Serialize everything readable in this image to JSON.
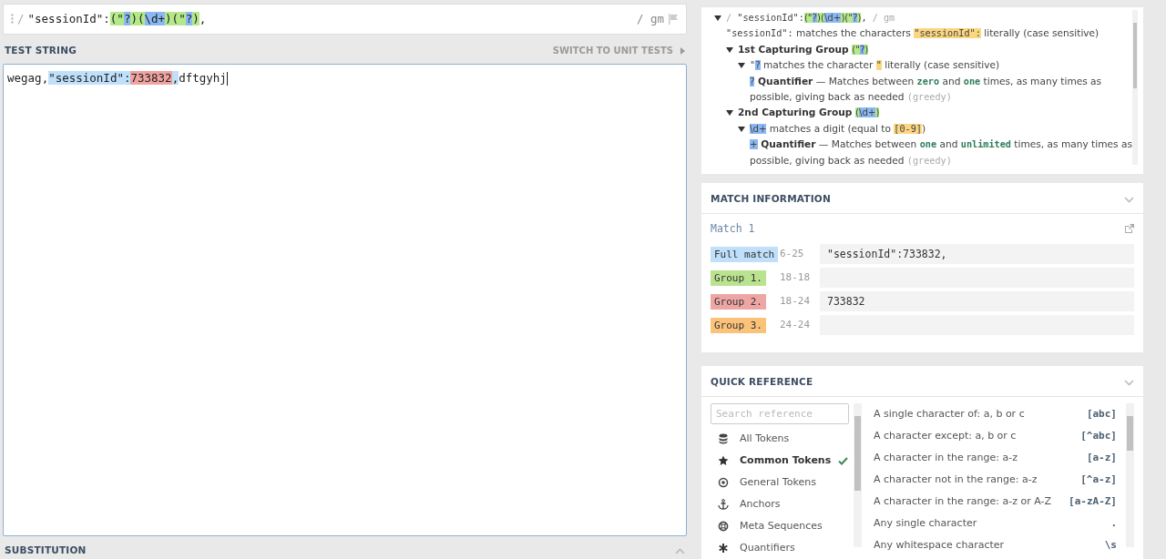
{
  "regex": {
    "delimiter": "/",
    "flags": "/ gm",
    "tokens": [
      {
        "t": "\"sessionId\":",
        "kind": "plain"
      },
      {
        "t": "(\"",
        "kind": "grp"
      },
      {
        "t": "?",
        "kind": "tok"
      },
      {
        "t": ")",
        "kind": "grp"
      },
      {
        "t": "(",
        "kind": "grp"
      },
      {
        "t": "\\d+",
        "kind": "tok"
      },
      {
        "t": ")",
        "kind": "grp"
      },
      {
        "t": "(\"",
        "kind": "grp"
      },
      {
        "t": "?",
        "kind": "tok"
      },
      {
        "t": ")",
        "kind": "grp"
      },
      {
        "t": ",",
        "kind": "plain"
      }
    ]
  },
  "test_string": {
    "title": "TEST STRING",
    "switch_label": "SWITCH TO UNIT TESTS",
    "caret": true,
    "tokens": [
      {
        "t": "wegag,",
        "kind": "plain"
      },
      {
        "t": "\"sessionId\":",
        "kind": "full"
      },
      {
        "t": "733832",
        "kind": "g2"
      },
      {
        "t": ",",
        "kind": "full"
      },
      {
        "t": "dftgyhj",
        "kind": "plain"
      }
    ]
  },
  "substitution": {
    "title": "SUBSTITUTION",
    "expanded": false
  },
  "explanation": {
    "tree": [
      {
        "expanded": true,
        "segs": [
          {
            "t": "/ ",
            "kind": "dim"
          },
          {
            "t": "\"sessionId\":",
            "kind": "code"
          },
          {
            "t": "(\"",
            "kind": "grp"
          },
          {
            "t": "?",
            "kind": "tok"
          },
          {
            "t": ")(",
            "kind": "grp"
          },
          {
            "t": "\\d+",
            "kind": "tok"
          },
          {
            "t": ")(\"",
            "kind": "grp"
          },
          {
            "t": "?",
            "kind": "tok"
          },
          {
            "t": ")",
            "kind": "grp"
          },
          {
            "t": ", ",
            "kind": "code"
          },
          {
            "t": "/ gm",
            "kind": "dim"
          }
        ],
        "children": [
          {
            "segs": [
              {
                "t": "\"sessionId\":",
                "kind": "code"
              },
              {
                "t": " matches the characters ",
                "kind": "plain"
              },
              {
                "t": "\"sessionId\":",
                "kind": "lit"
              },
              {
                "t": " literally (case sensitive)",
                "kind": "plain"
              }
            ]
          },
          {
            "expanded": true,
            "segs": [
              {
                "t": "1st Capturing Group ",
                "kind": "bold"
              },
              {
                "t": "(\"",
                "kind": "grp"
              },
              {
                "t": "?",
                "kind": "tok"
              },
              {
                "t": ")",
                "kind": "grp"
              }
            ],
            "children": [
              {
                "expanded": true,
                "segs": [
                  {
                    "t": "\"",
                    "kind": "code"
                  },
                  {
                    "t": "?",
                    "kind": "tok"
                  },
                  {
                    "t": " matches the character ",
                    "kind": "plain"
                  },
                  {
                    "t": "\"",
                    "kind": "lit"
                  },
                  {
                    "t": " literally (case sensitive)",
                    "kind": "plain"
                  }
                ],
                "children": [
                  {
                    "segs": [
                      {
                        "t": "?",
                        "kind": "tok"
                      },
                      {
                        "t": " Quantifier",
                        "kind": "bold"
                      },
                      {
                        "t": " — Matches between ",
                        "kind": "plain"
                      },
                      {
                        "t": "zero",
                        "kind": "kw"
                      },
                      {
                        "t": " and ",
                        "kind": "plain"
                      },
                      {
                        "t": "one",
                        "kind": "kw"
                      },
                      {
                        "t": " times, as many times as possible, giving back as needed ",
                        "kind": "plain"
                      },
                      {
                        "t": "(greedy)",
                        "kind": "dim"
                      }
                    ]
                  }
                ]
              }
            ]
          },
          {
            "expanded": true,
            "segs": [
              {
                "t": "2nd Capturing Group ",
                "kind": "bold"
              },
              {
                "t": "(",
                "kind": "grp"
              },
              {
                "t": "\\d+",
                "kind": "tok"
              },
              {
                "t": ")",
                "kind": "grp"
              }
            ],
            "children": [
              {
                "expanded": true,
                "segs": [
                  {
                    "t": "\\d+",
                    "kind": "tok"
                  },
                  {
                    "t": " matches a digit (equal to ",
                    "kind": "plain"
                  },
                  {
                    "t": "[0-9]",
                    "kind": "lit"
                  },
                  {
                    "t": ")",
                    "kind": "plain"
                  }
                ],
                "children": [
                  {
                    "segs": [
                      {
                        "t": "+",
                        "kind": "tok"
                      },
                      {
                        "t": " Quantifier",
                        "kind": "bold"
                      },
                      {
                        "t": " — Matches between ",
                        "kind": "plain"
                      },
                      {
                        "t": "one",
                        "kind": "kw"
                      },
                      {
                        "t": " and ",
                        "kind": "plain"
                      },
                      {
                        "t": "unlimited",
                        "kind": "kw"
                      },
                      {
                        "t": " times, as many times as possible, giving back as needed ",
                        "kind": "plain"
                      },
                      {
                        "t": "(greedy)",
                        "kind": "dim"
                      }
                    ]
                  }
                ]
              }
            ]
          }
        ]
      }
    ]
  },
  "match_information": {
    "title": "MATCH INFORMATION",
    "expanded": true,
    "match_title": "Match 1",
    "rows": [
      {
        "label": "Full match",
        "color": "#bfdffa",
        "range": "6-25",
        "value": "\"sessionId\":733832,"
      },
      {
        "label": "Group 1.",
        "color": "#b9e38f",
        "range": "18-18",
        "value": ""
      },
      {
        "label": "Group 2.",
        "color": "#eea6a4",
        "range": "18-24",
        "value": "733832"
      },
      {
        "label": "Group 3.",
        "color": "#fbc27a",
        "range": "24-24",
        "value": ""
      }
    ]
  },
  "quick_reference": {
    "title": "QUICK REFERENCE",
    "expanded": true,
    "search": {
      "placeholder": "Search reference"
    },
    "categories": [
      {
        "label": "All Tokens",
        "kind": "all",
        "selected": false
      },
      {
        "label": "Common Tokens",
        "kind": "common",
        "selected": true
      },
      {
        "label": "General Tokens",
        "kind": "general",
        "selected": false
      },
      {
        "label": "Anchors",
        "kind": "anchors",
        "selected": false
      },
      {
        "label": "Meta Sequences",
        "kind": "meta",
        "selected": false
      },
      {
        "label": "Quantifiers",
        "kind": "quantifiers",
        "selected": false
      }
    ],
    "tokens": [
      {
        "description": "A single character of: a, b or c",
        "token": "[abc]"
      },
      {
        "description": "A character except: a, b or c",
        "token": "[^abc]"
      },
      {
        "description": "A character in the range: a-z",
        "token": "[a-z]"
      },
      {
        "description": "A character not in the range: a-z",
        "token": "[^a-z]"
      },
      {
        "description": "A character in the range: a-z or A-Z",
        "token": "[a-zA-Z]"
      },
      {
        "description": "Any single character",
        "token": "."
      },
      {
        "description": "Any whitespace character",
        "token": "\\s"
      }
    ]
  }
}
